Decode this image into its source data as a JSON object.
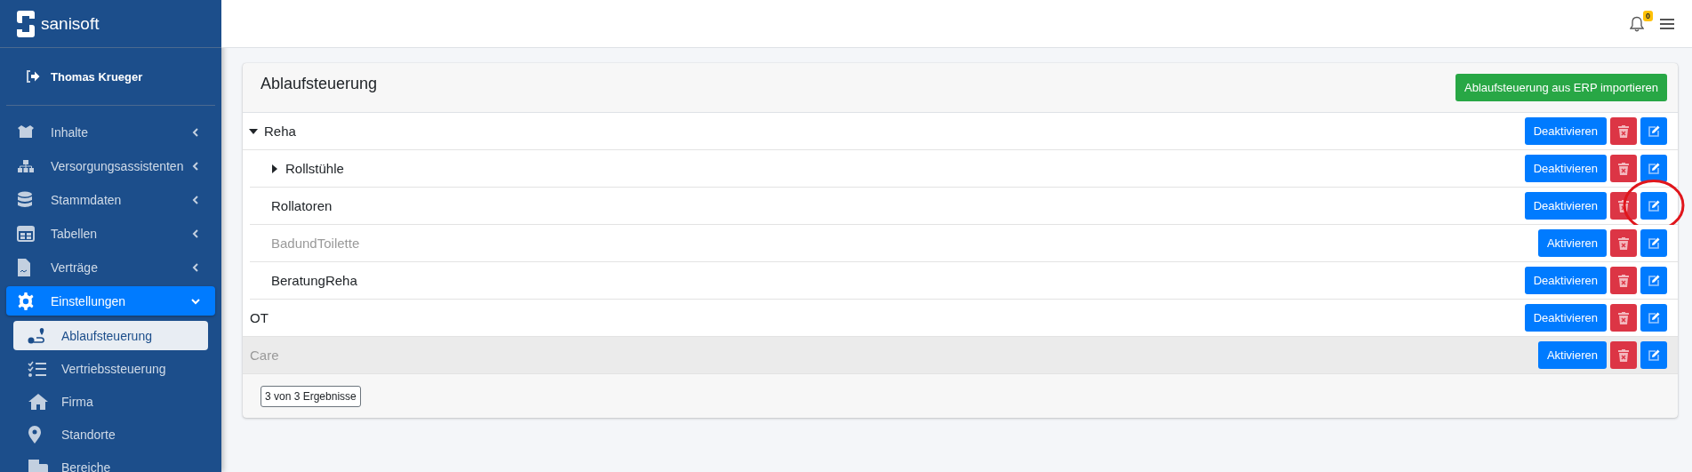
{
  "brand": {
    "name": "sanisoft"
  },
  "user": {
    "name": "Thomas Krueger"
  },
  "sidebar": {
    "items": [
      {
        "label": "Inhalte",
        "expanded": false,
        "selected": false
      },
      {
        "label": "Versorgungsassistenten",
        "expanded": false,
        "selected": false
      },
      {
        "label": "Stammdaten",
        "expanded": false,
        "selected": false
      },
      {
        "label": "Tabellen",
        "expanded": false,
        "selected": false
      },
      {
        "label": "Verträge",
        "expanded": false,
        "selected": false
      },
      {
        "label": "Einstellungen",
        "expanded": true,
        "selected": true,
        "children": [
          {
            "label": "Ablaufsteuerung",
            "selected": true
          },
          {
            "label": "Vertriebssteuerung",
            "selected": false
          },
          {
            "label": "Firma",
            "selected": false
          },
          {
            "label": "Standorte",
            "selected": false
          },
          {
            "label": "Bereiche",
            "selected": false
          }
        ]
      }
    ]
  },
  "header": {
    "notification_count": "0"
  },
  "card": {
    "title": "Ablaufsteuerung",
    "import_button": "Ablaufsteuerung aus ERP importieren",
    "tree": [
      {
        "label": "Reha",
        "active": true,
        "expanded": true,
        "highlighted": false,
        "toggle_button": "Deaktivieren",
        "annotated": false,
        "children": [
          {
            "label": "Rollstühle",
            "active": true,
            "expanded": false,
            "highlighted": false,
            "toggle_button": "Deaktivieren",
            "annotated": false
          },
          {
            "label": "Rollatoren",
            "active": true,
            "highlighted": false,
            "toggle_button": "Deaktivieren",
            "annotated": true
          },
          {
            "label": "BadundToilette",
            "active": false,
            "highlighted": false,
            "toggle_button": "Aktivieren",
            "annotated": false
          },
          {
            "label": "BeratungReha",
            "active": true,
            "highlighted": false,
            "toggle_button": "Deaktivieren",
            "annotated": false
          }
        ]
      },
      {
        "label": "OT",
        "active": true,
        "highlighted": false,
        "toggle_button": "Deaktivieren",
        "annotated": false
      },
      {
        "label": "Care",
        "active": false,
        "highlighted": true,
        "toggle_button": "Aktivieren",
        "annotated": false
      }
    ],
    "result_count": "3 von 3 Ergebnisse"
  }
}
